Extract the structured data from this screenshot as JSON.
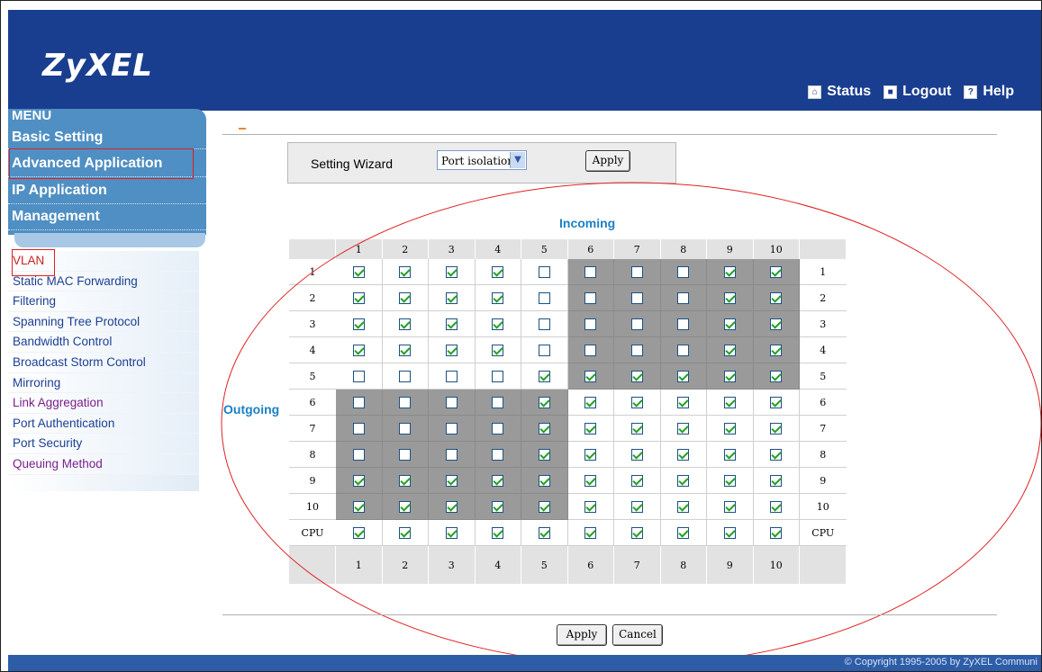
{
  "header": {
    "logo": "ZyXEL",
    "links": [
      {
        "label": "Status",
        "icon": "home-icon"
      },
      {
        "label": "Logout",
        "icon": "logout-icon"
      },
      {
        "label": "Help",
        "icon": "help-icon"
      }
    ]
  },
  "menu": {
    "title": "MENU",
    "items": [
      "Basic Setting",
      "Advanced Application",
      "IP Application",
      "Management"
    ],
    "highlighted": "Advanced Application"
  },
  "submenu": {
    "items": [
      {
        "label": "VLAN",
        "color": "#cc2222"
      },
      {
        "label": "Static MAC Forwarding",
        "color": "#1c3f94"
      },
      {
        "label": "Filtering",
        "color": "#1c3f94"
      },
      {
        "label": "Spanning Tree Protocol",
        "color": "#1c3f94"
      },
      {
        "label": "Bandwidth Control",
        "color": "#1c3f94"
      },
      {
        "label": "Broadcast Storm Control",
        "color": "#1c3f94"
      },
      {
        "label": "Mirroring",
        "color": "#1c3f94"
      },
      {
        "label": "Link Aggregation",
        "color": "#7a1f8c"
      },
      {
        "label": "Port Authentication",
        "color": "#1c3f94"
      },
      {
        "label": "Port Security",
        "color": "#1c3f94"
      },
      {
        "label": "Queuing Method",
        "color": "#7a1f8c"
      }
    ]
  },
  "wizard": {
    "label": "Setting Wizard",
    "selected": "Port isolation",
    "apply_label": "Apply"
  },
  "matrix": {
    "incoming_label": "Incoming",
    "outgoing_label": "Outgoing",
    "columns": [
      "1",
      "2",
      "3",
      "4",
      "5",
      "6",
      "7",
      "8",
      "9",
      "10"
    ],
    "rows": [
      "1",
      "2",
      "3",
      "4",
      "5",
      "6",
      "7",
      "8",
      "9",
      "10",
      "CPU"
    ],
    "checked": [
      [
        1,
        1,
        1,
        1,
        0,
        0,
        0,
        0,
        1,
        1
      ],
      [
        1,
        1,
        1,
        1,
        0,
        0,
        0,
        0,
        1,
        1
      ],
      [
        1,
        1,
        1,
        1,
        0,
        0,
        0,
        0,
        1,
        1
      ],
      [
        1,
        1,
        1,
        1,
        0,
        0,
        0,
        0,
        1,
        1
      ],
      [
        0,
        0,
        0,
        0,
        1,
        1,
        1,
        1,
        1,
        1
      ],
      [
        0,
        0,
        0,
        0,
        1,
        1,
        1,
        1,
        1,
        1
      ],
      [
        0,
        0,
        0,
        0,
        1,
        1,
        1,
        1,
        1,
        1
      ],
      [
        0,
        0,
        0,
        0,
        1,
        1,
        1,
        1,
        1,
        1
      ],
      [
        1,
        1,
        1,
        1,
        1,
        1,
        1,
        1,
        1,
        1
      ],
      [
        1,
        1,
        1,
        1,
        1,
        1,
        1,
        1,
        1,
        1
      ],
      [
        1,
        1,
        1,
        1,
        1,
        1,
        1,
        1,
        1,
        1
      ]
    ],
    "shaded": [
      [
        0,
        0,
        0,
        0,
        0,
        1,
        1,
        1,
        1,
        1
      ],
      [
        0,
        0,
        0,
        0,
        0,
        1,
        1,
        1,
        1,
        1
      ],
      [
        0,
        0,
        0,
        0,
        0,
        1,
        1,
        1,
        1,
        1
      ],
      [
        0,
        0,
        0,
        0,
        0,
        1,
        1,
        1,
        1,
        1
      ],
      [
        0,
        0,
        0,
        0,
        0,
        1,
        1,
        1,
        1,
        1
      ],
      [
        1,
        1,
        1,
        1,
        1,
        0,
        0,
        0,
        0,
        0
      ],
      [
        1,
        1,
        1,
        1,
        1,
        0,
        0,
        0,
        0,
        0
      ],
      [
        1,
        1,
        1,
        1,
        1,
        0,
        0,
        0,
        0,
        0
      ],
      [
        1,
        1,
        1,
        1,
        1,
        0,
        0,
        0,
        0,
        0
      ],
      [
        1,
        1,
        1,
        1,
        1,
        0,
        0,
        0,
        0,
        0
      ],
      [
        0,
        0,
        0,
        0,
        0,
        0,
        0,
        0,
        0,
        0
      ]
    ]
  },
  "buttons": {
    "apply": "Apply",
    "cancel": "Cancel"
  },
  "footer": {
    "copyright": "© Copyright 1995-2005 by ZyXEL Communi"
  },
  "colors": {
    "header": "#1a3e8f",
    "menu": "#4f8fc3",
    "annotation": "#e02020",
    "accent": "#1c80c4"
  }
}
